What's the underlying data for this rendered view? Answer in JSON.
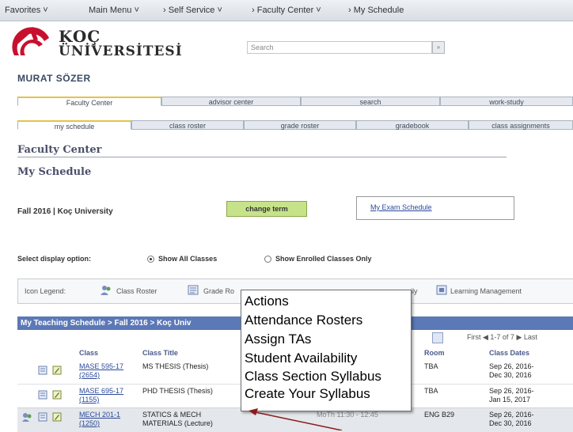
{
  "nav": {
    "favorites": "Favorites ˅",
    "main_menu": "Main Menu ˅",
    "self_service": "›  Self Service ˅",
    "faculty_center": "›  Faculty Center ˅",
    "my_schedule": "›  My Schedule"
  },
  "logo": {
    "line1": "KOÇ",
    "line2": "ÜNİVERSİTESİ"
  },
  "search": {
    "value": "Search"
  },
  "user": {
    "name": "MURAT SÖZER"
  },
  "tabs1": [
    "Faculty Center",
    "advisor center",
    "search",
    "work-study"
  ],
  "tabs2": [
    "my schedule",
    "class roster",
    "grade roster",
    "gradebook",
    "class assignments"
  ],
  "headings": {
    "faculty_center": "Faculty Center",
    "my_schedule": "My Schedule"
  },
  "term": {
    "label": "Fall 2016 | Koç University",
    "change_button": "change term",
    "exam_link": "My Exam Schedule"
  },
  "display": {
    "label": "Select display option:",
    "option_all": "Show All Classes",
    "option_enrolled": "Show Enrolled Classes Only",
    "selected": "option_all"
  },
  "legend": {
    "label": "Icon Legend:",
    "items": [
      "Class Roster",
      "Grade Ro",
      "ily",
      "Learning Management"
    ]
  },
  "schedule": {
    "title": "My Teaching Schedule > Fall 2016 > Koç Univ",
    "pager": "First ◀ 1-7 of 7 ▶ Last",
    "columns": [
      "Class",
      "Class Title",
      "Room",
      "Class Dates"
    ],
    "rows": [
      {
        "class_line1": "MASE 595-17",
        "class_line2": "(2654)",
        "title": "MS THESIS (Thesis)",
        "room": "TBA",
        "dates_line1": "Sep 26, 2016-",
        "dates_line2": "Dec 30, 2016"
      },
      {
        "class_line1": "MASE 695-17",
        "class_line2": "(1155)",
        "title": "PHD THESIS (Thesis)",
        "room": "TBA",
        "dates_line1": "Sep 26, 2016-",
        "dates_line2": "Jan 15, 2017"
      },
      {
        "class_line1": "MECH 201-1",
        "class_line2": "(1250)",
        "title_line1": "STATICS & MECH",
        "title_line2": "MATERIALS (Lecture)",
        "time": "MoTh 11:30 - 12:45",
        "room": "ENG B29",
        "dates_line1": "Sep 26, 2016-",
        "dates_line2": "Dec 30, 2016"
      }
    ]
  },
  "popup": {
    "items": [
      "Actions",
      "Attendance Rosters",
      "Assign TAs",
      "Student Availability",
      "Class Section Syllabus",
      "Create Your Syllabus"
    ]
  },
  "colors": {
    "accent": "#5b78b7",
    "button": "#c7e38a",
    "logo_red": "#c8102e",
    "arrow": "#8b1a1a"
  }
}
